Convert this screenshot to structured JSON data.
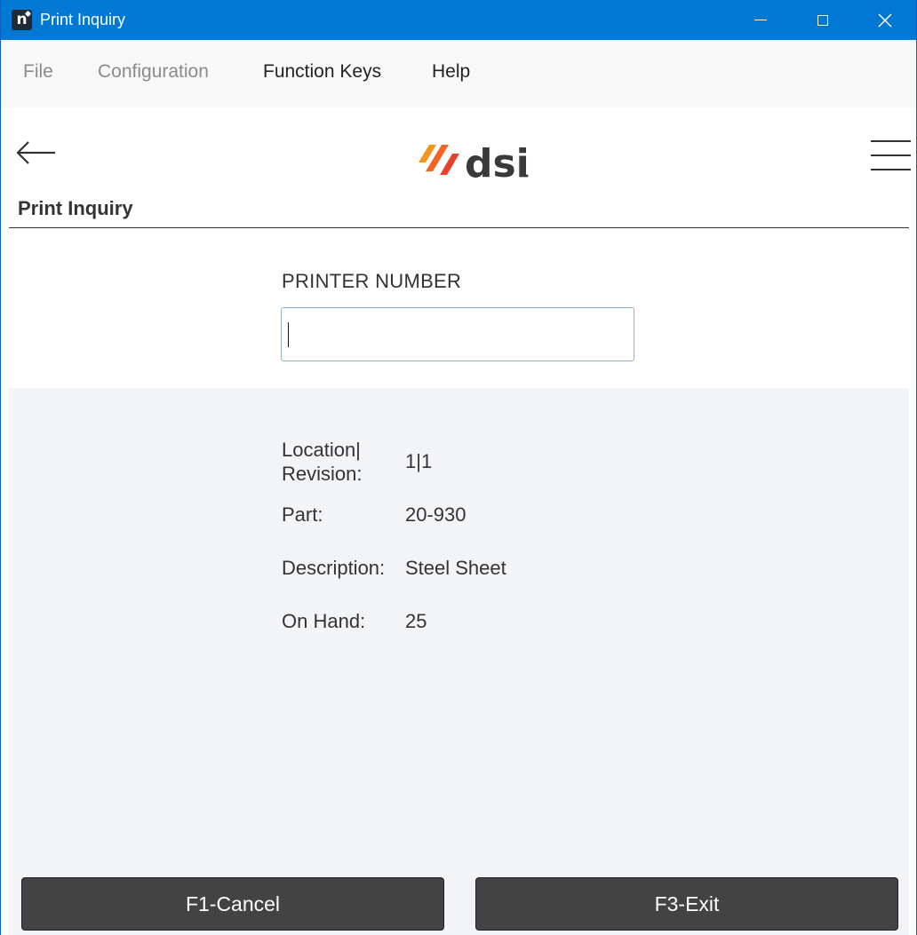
{
  "window": {
    "title": "Print Inquiry",
    "app_icon_letter": "n",
    "controls": [
      "minimize-icon",
      "maximize-icon",
      "close-icon"
    ]
  },
  "menu": {
    "items": [
      {
        "label": "File",
        "enabled": false
      },
      {
        "label": "Configuration",
        "enabled": false
      },
      {
        "label": "Function Keys",
        "enabled": true
      },
      {
        "label": "Help",
        "enabled": true
      }
    ]
  },
  "header": {
    "logo_text": "dsi",
    "logo_colors": {
      "slash": "#f26522",
      "text": "#3a3a3a"
    },
    "page_title": "Print Inquiry"
  },
  "form": {
    "printer_number_label": "PRINTER NUMBER",
    "printer_number_value": "",
    "printer_number_placeholder": ""
  },
  "info": {
    "location_revision_label_line1": "Location|",
    "location_revision_label_line2": "Revision:",
    "location_revision_value": "1|1",
    "part_label": "Part:",
    "part_value": "20-930",
    "description_label": "Description:",
    "description_value": "Steel Sheet",
    "on_hand_label": "On Hand:",
    "on_hand_value": "25"
  },
  "buttons": {
    "cancel_label": "F1-Cancel",
    "exit_label": "F3-Exit"
  },
  "colors": {
    "titlebar": "#0078d4",
    "button_bg": "#434343",
    "panel_bg": "#f3f4f7"
  }
}
